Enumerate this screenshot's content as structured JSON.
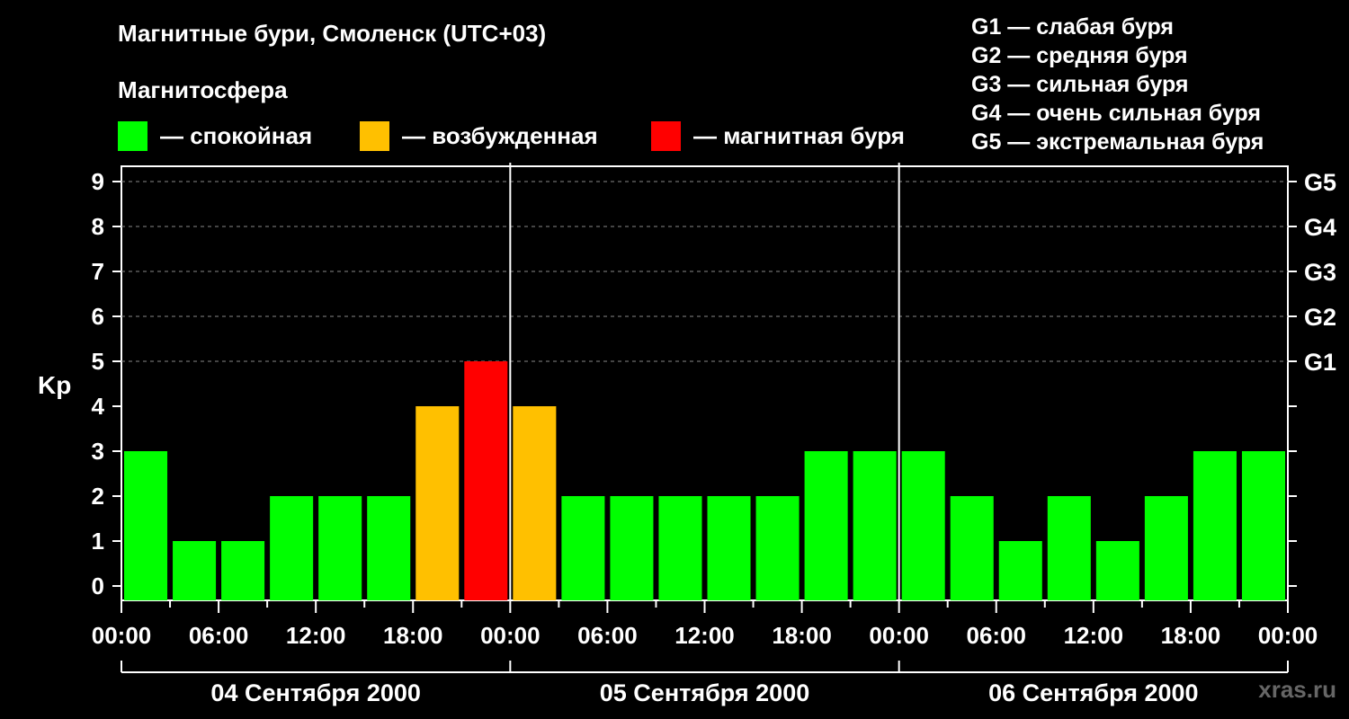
{
  "title": "Магнитные бури, Смоленск (UTC+03)",
  "subtitle": "Магнитосфера",
  "legend": [
    {
      "label": "— спокойная",
      "color": "#00ff00"
    },
    {
      "label": "— возбужденная",
      "color": "#ffc000"
    },
    {
      "label": "— магнитная буря",
      "color": "#ff0000"
    }
  ],
  "storm_levels": [
    "G1 — слабая буря",
    "G2 — средняя буря",
    "G3 — сильная буря",
    "G4 — очень сильная буря",
    "G5 — экстремальная буря"
  ],
  "watermark": "xras.ru",
  "colors": {
    "calm": "#00ff00",
    "disturbed": "#ffc000",
    "storm": "#ff0000",
    "background": "#000000",
    "grid": "#888888"
  },
  "chart_data": {
    "type": "bar",
    "ylabel": "Kp",
    "ylim": [
      0,
      9
    ],
    "y_ticks": [
      "0",
      "1",
      "2",
      "3",
      "4",
      "5",
      "6",
      "7",
      "8",
      "9"
    ],
    "right_axis_ticks": [
      {
        "kp": 5,
        "label": "G1"
      },
      {
        "kp": 6,
        "label": "G2"
      },
      {
        "kp": 7,
        "label": "G3"
      },
      {
        "kp": 8,
        "label": "G4"
      },
      {
        "kp": 9,
        "label": "G5"
      }
    ],
    "x_tick_labels": [
      "00:00",
      "06:00",
      "12:00",
      "18:00",
      "00:00",
      "06:00",
      "12:00",
      "18:00",
      "00:00",
      "06:00",
      "12:00",
      "18:00",
      "00:00"
    ],
    "days": [
      "04 Сентября 2000",
      "05 Сентября 2000",
      "06 Сентября 2000"
    ],
    "grid": true,
    "values": [
      3,
      1,
      1,
      2,
      2,
      2,
      4,
      5,
      4,
      2,
      2,
      2,
      2,
      2,
      3,
      3,
      3,
      2,
      1,
      2,
      1,
      2,
      3,
      3
    ],
    "levels": [
      "calm",
      "calm",
      "calm",
      "calm",
      "calm",
      "calm",
      "disturbed",
      "storm",
      "disturbed",
      "calm",
      "calm",
      "calm",
      "calm",
      "calm",
      "calm",
      "calm",
      "calm",
      "calm",
      "calm",
      "calm",
      "calm",
      "calm",
      "calm",
      "calm"
    ]
  }
}
